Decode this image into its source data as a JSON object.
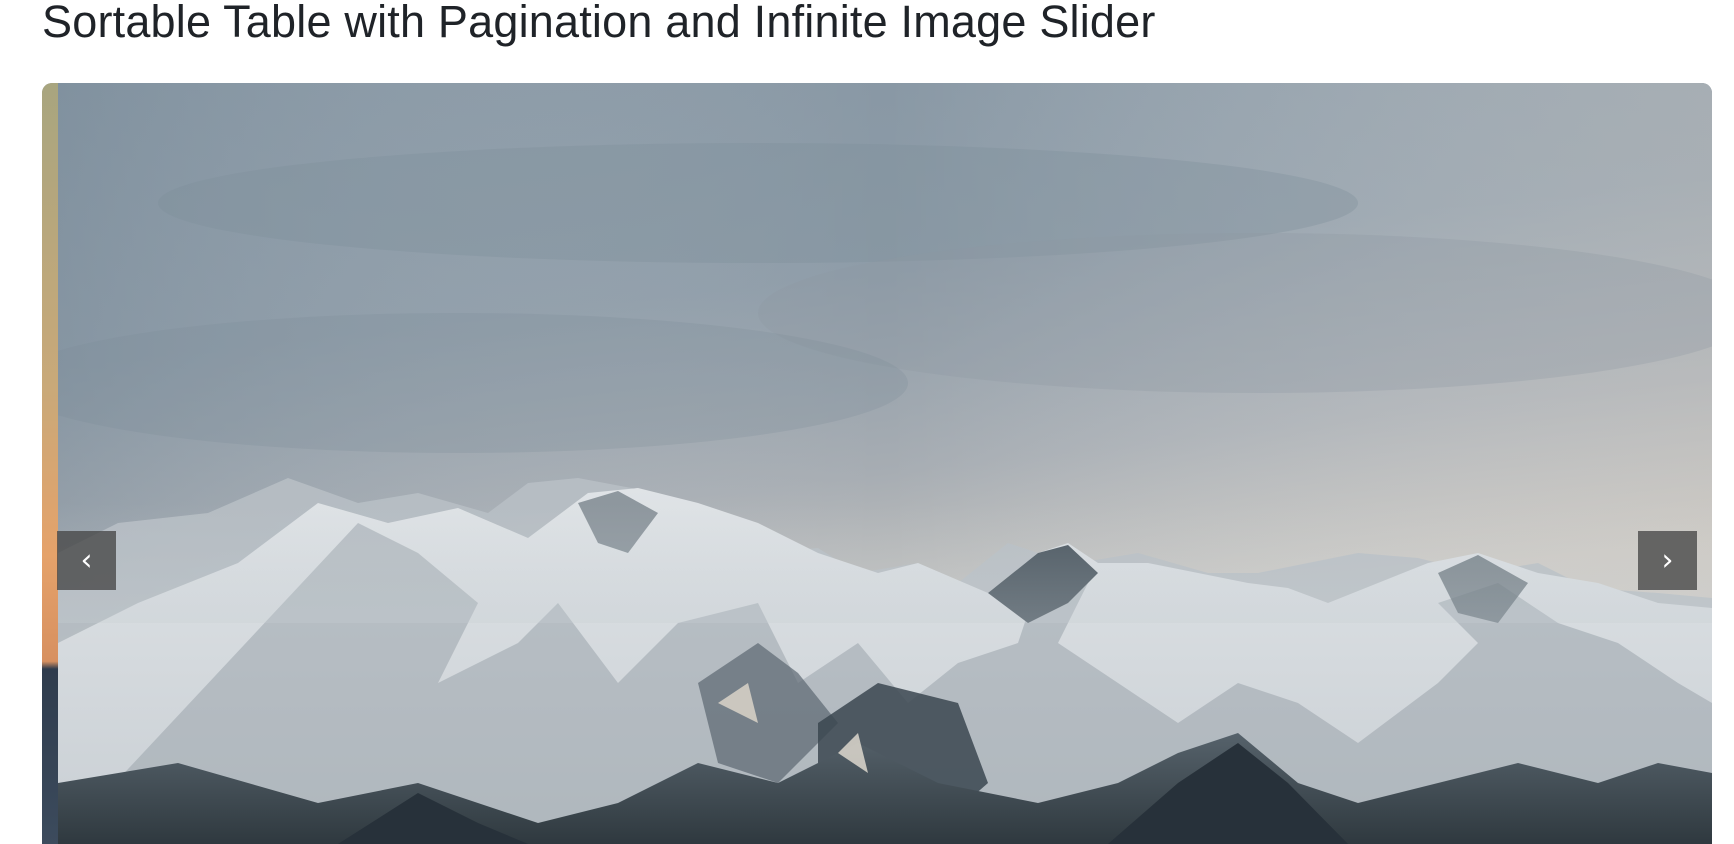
{
  "page": {
    "title": "Sortable Table with Pagination and Infinite Image Slider"
  },
  "slider": {
    "prev_label": "‹",
    "next_label": "›",
    "prev_icon": "chevron-left-icon",
    "next_icon": "chevron-right-icon",
    "current_image": "snowy-mountain-range-under-overcast-sky",
    "adjacent_image": "sunset-over-water",
    "colors": {
      "sky_top": "#8b9aa7",
      "sky_bottom": "#c9c6c0",
      "snow": "#e8eaec",
      "rock": "#4a555d",
      "forest": "#2c353c",
      "button_bg": "#464646"
    }
  }
}
